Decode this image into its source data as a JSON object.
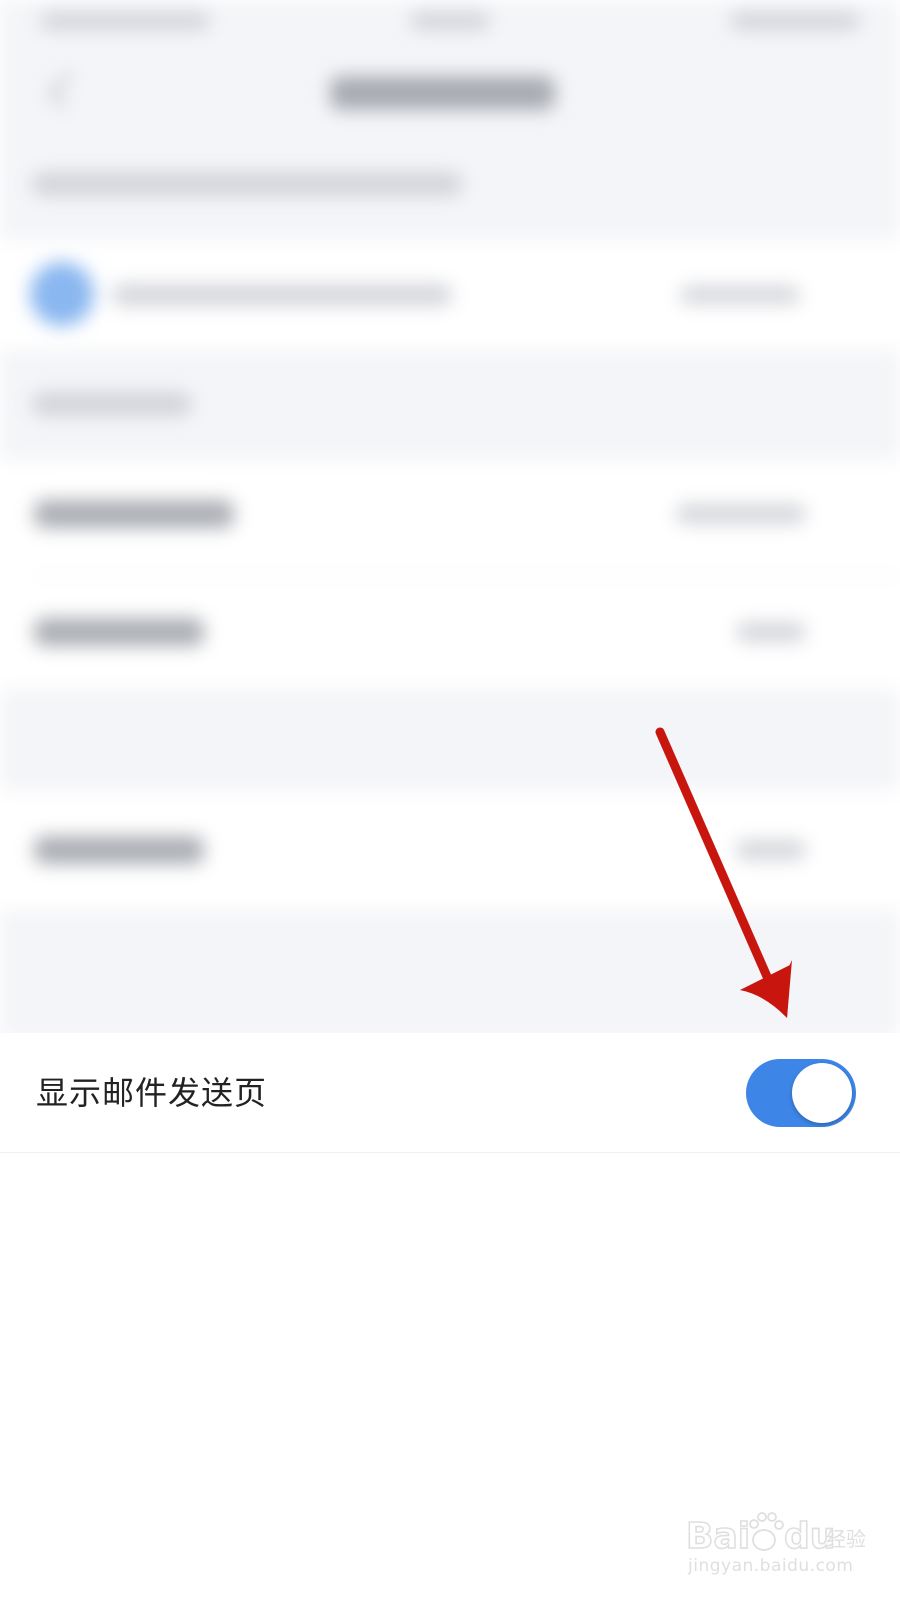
{
  "setting": {
    "label": "显示邮件发送页",
    "enabled": true
  },
  "colors": {
    "toggle_on": "#3d86e8",
    "annotation": "#c8160e",
    "background": "#f4f5f8"
  },
  "watermark": {
    "brand": "Baidu经验",
    "url": "jingyan.baidu.com"
  },
  "icons": {
    "back": "back-arrow-icon",
    "avatar": "avatar-icon"
  }
}
